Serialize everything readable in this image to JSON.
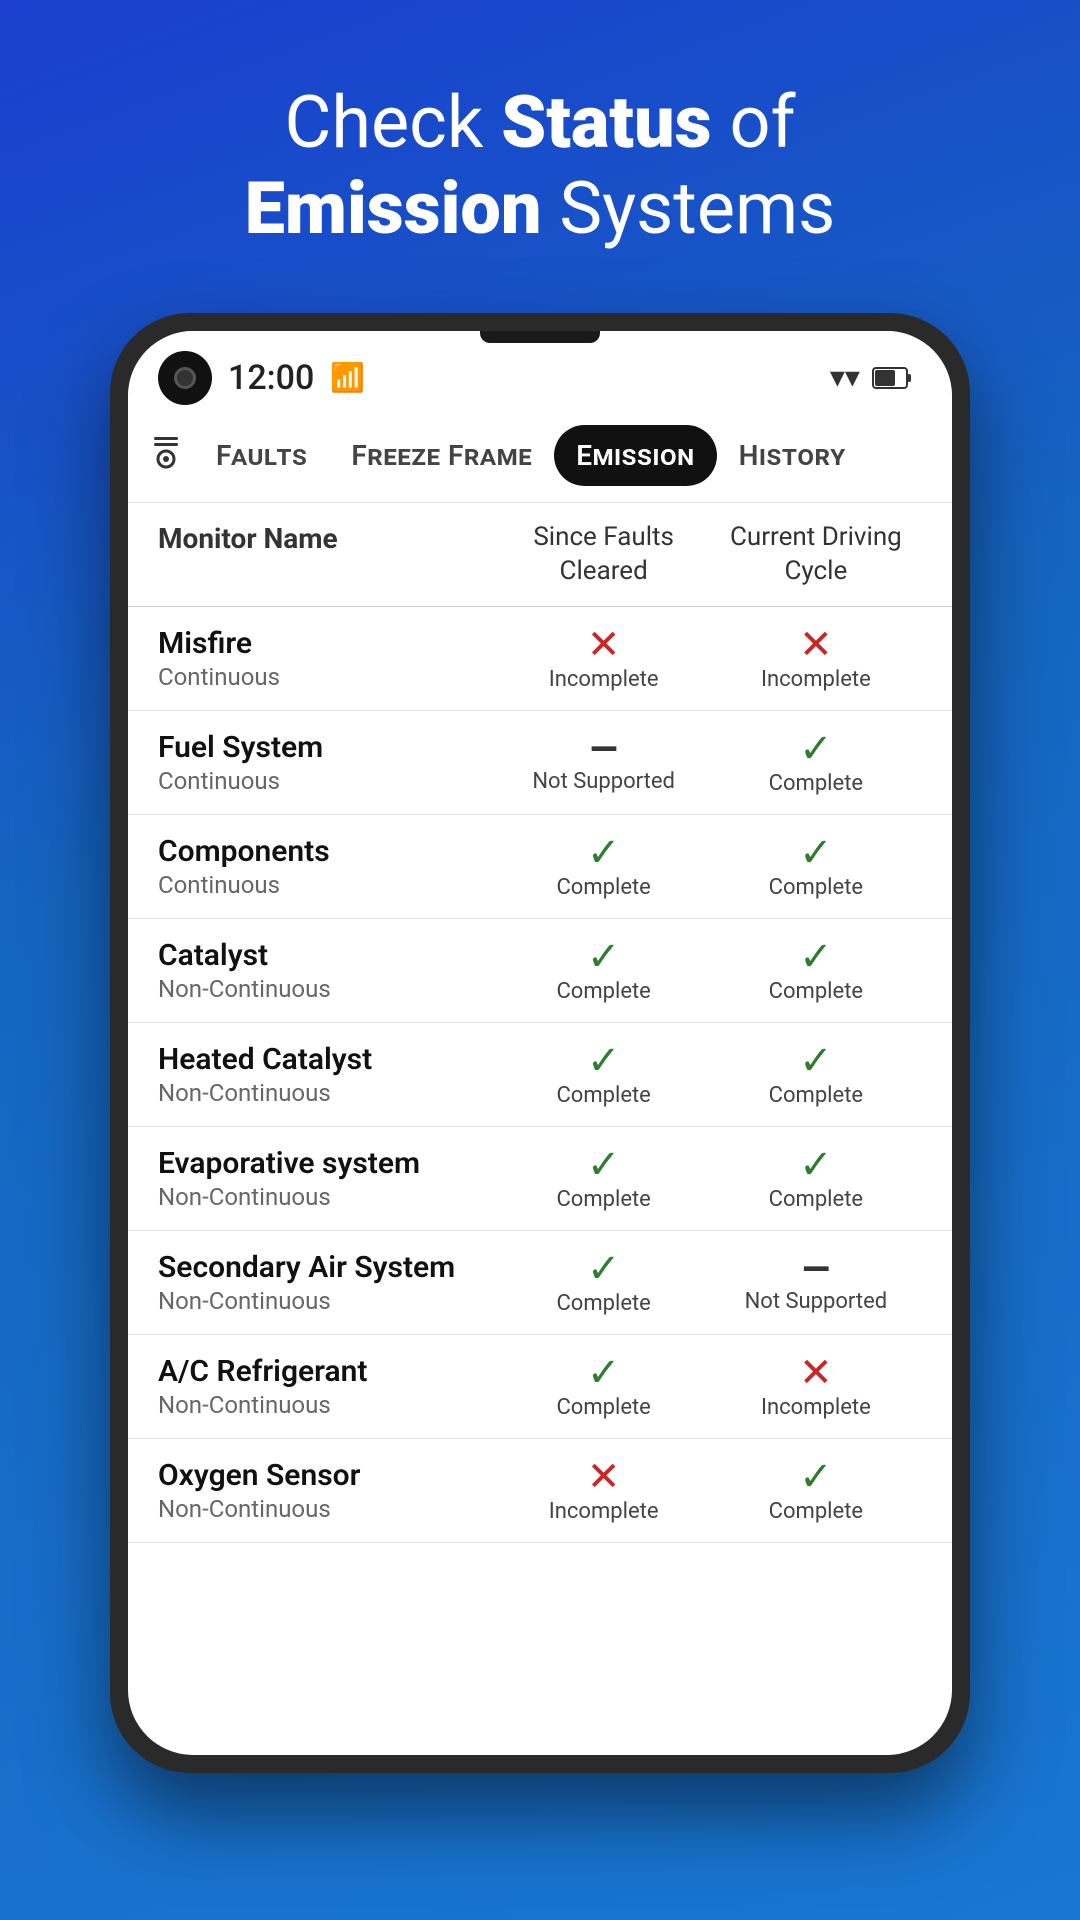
{
  "hero": {
    "line1_normal": "Check ",
    "line1_bold": "Status",
    "line1_end": " of",
    "line2_bold": "Emission",
    "line2_end": " Systems"
  },
  "status_bar": {
    "time": "12:00"
  },
  "nav": {
    "icon": "⊟",
    "tabs": [
      {
        "label": "Faults",
        "active": false
      },
      {
        "label": "Freeze Frame",
        "active": false
      },
      {
        "label": "Emission",
        "active": true
      },
      {
        "label": "History",
        "active": false
      }
    ]
  },
  "table": {
    "headers": {
      "monitor": "Monitor Name",
      "since_faults": "Since Faults Cleared",
      "current_cycle": "Current Driving Cycle"
    },
    "rows": [
      {
        "name": "Misfire",
        "type": "Continuous",
        "since_faults": {
          "icon": "cross",
          "label": "Incomplete"
        },
        "current_cycle": {
          "icon": "cross",
          "label": "Incomplete"
        }
      },
      {
        "name": "Fuel System",
        "type": "Continuous",
        "since_faults": {
          "icon": "dash",
          "label": "Not Supported"
        },
        "current_cycle": {
          "icon": "check",
          "label": "Complete"
        }
      },
      {
        "name": "Components",
        "type": "Continuous",
        "since_faults": {
          "icon": "check",
          "label": "Complete"
        },
        "current_cycle": {
          "icon": "check",
          "label": "Complete"
        }
      },
      {
        "name": "Catalyst",
        "type": "Non-Continuous",
        "since_faults": {
          "icon": "check",
          "label": "Complete"
        },
        "current_cycle": {
          "icon": "check",
          "label": "Complete"
        }
      },
      {
        "name": "Heated Catalyst",
        "type": "Non-Continuous",
        "since_faults": {
          "icon": "check",
          "label": "Complete"
        },
        "current_cycle": {
          "icon": "check",
          "label": "Complete"
        }
      },
      {
        "name": "Evaporative system",
        "type": "Non-Continuous",
        "since_faults": {
          "icon": "check",
          "label": "Complete"
        },
        "current_cycle": {
          "icon": "check",
          "label": "Complete"
        }
      },
      {
        "name": "Secondary Air System",
        "type": "Non-Continuous",
        "since_faults": {
          "icon": "check",
          "label": "Complete"
        },
        "current_cycle": {
          "icon": "dash",
          "label": "Not Supported"
        }
      },
      {
        "name": "A/C Refrigerant",
        "type": "Non-Continuous",
        "since_faults": {
          "icon": "check",
          "label": "Complete"
        },
        "current_cycle": {
          "icon": "cross",
          "label": "Incomplete"
        }
      },
      {
        "name": "Oxygen Sensor",
        "type": "Non-Continuous",
        "since_faults": {
          "icon": "cross",
          "label": "Incomplete"
        },
        "current_cycle": {
          "icon": "check",
          "label": "Complete"
        }
      }
    ]
  }
}
